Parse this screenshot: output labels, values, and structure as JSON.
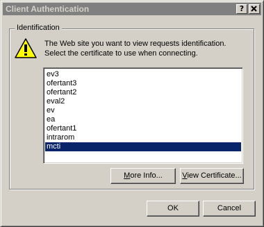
{
  "window": {
    "title": "Client Authentication",
    "help_label": "?",
    "close_label": "X"
  },
  "group": {
    "label": "Identification",
    "message_line1": "The Web site you want to view requests identification.",
    "message_line2": "Select the certificate to use when connecting."
  },
  "certificates": {
    "items": [
      "ev3",
      "ofertant3",
      "ofertant2",
      "eval2",
      "ev",
      "ea",
      "ofertant1",
      "intrarom",
      "mcti"
    ],
    "selected": "mcti"
  },
  "buttons": {
    "more_info": {
      "accel": "M",
      "rest": "ore Info..."
    },
    "view_certificate": {
      "accel": "V",
      "rest": "iew Certificate..."
    },
    "ok": "OK",
    "cancel": "Cancel"
  },
  "icons": {
    "warning": "warning-triangle-icon",
    "help": "help-icon",
    "close": "close-icon"
  },
  "colors": {
    "titlebar_inactive": "#808080",
    "selection": "#0a246a",
    "face": "#d4d0c8",
    "warning_yellow": "#ffff00"
  }
}
